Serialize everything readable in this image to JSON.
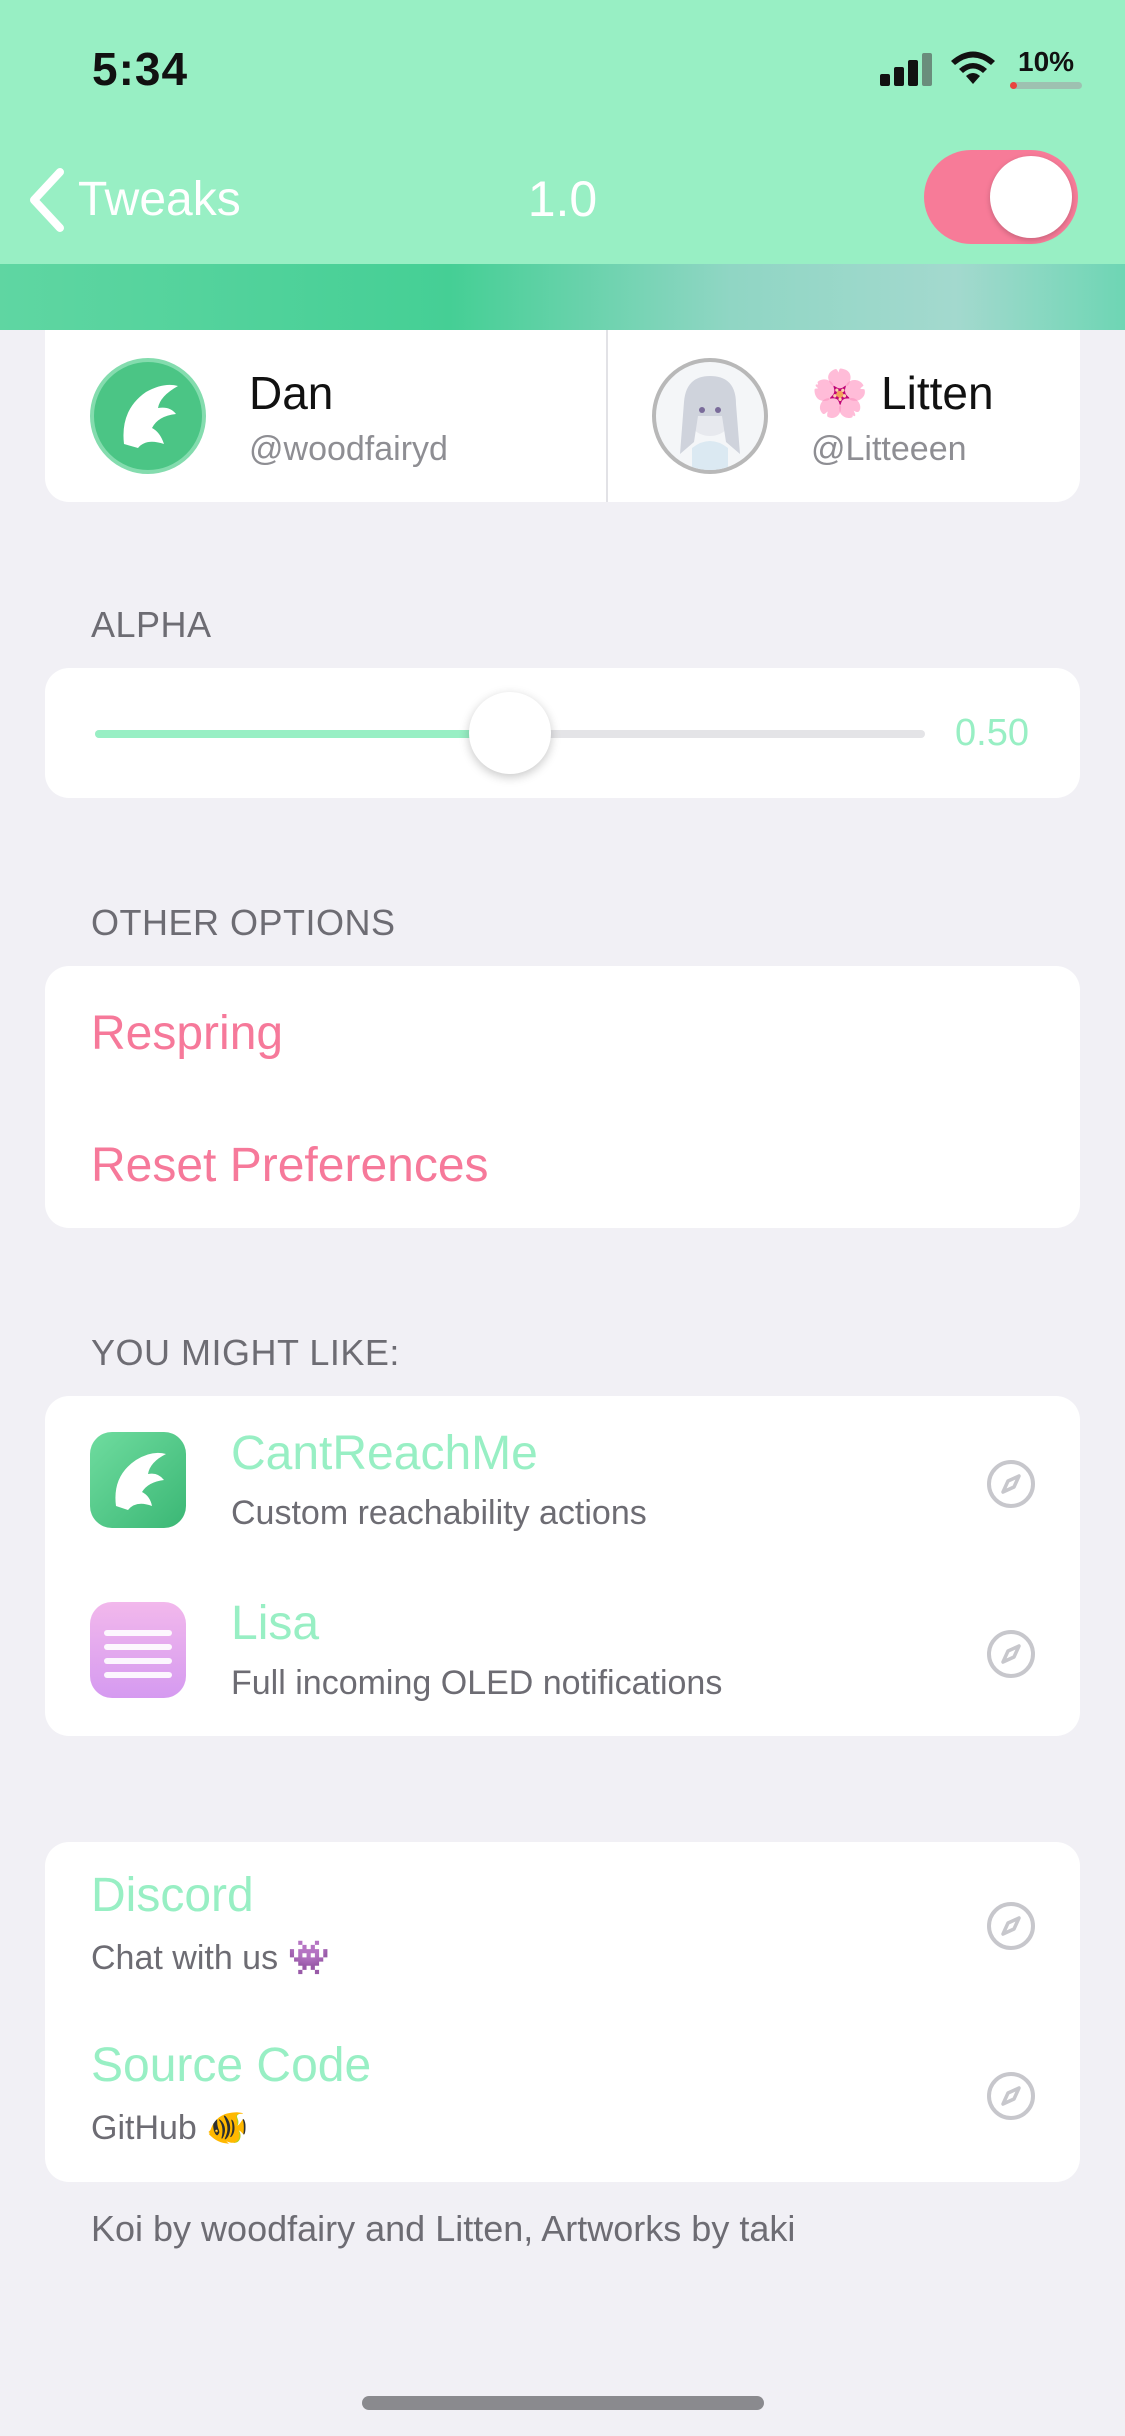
{
  "status_bar": {
    "time": "5:34",
    "battery": "10%",
    "battery_level": 0.1
  },
  "nav": {
    "back_label": "Tweaks",
    "title": "1.0",
    "toggle_on": true
  },
  "authors": [
    {
      "name": "Dan",
      "handle": "@woodfairyd"
    },
    {
      "name": "🌸 Litten",
      "handle": "@Litteeen"
    }
  ],
  "alpha": {
    "label": "ALPHA",
    "value": 0.5,
    "value_text": "0.50"
  },
  "other_options": {
    "label": "OTHER OPTIONS",
    "items": [
      "Respring",
      "Reset Preferences"
    ]
  },
  "you_might_like": {
    "label": "YOU MIGHT LIKE:",
    "items": [
      {
        "title": "CantReachMe",
        "subtitle": "Custom reachability actions",
        "icon": "cantreachme-icon"
      },
      {
        "title": "Lisa",
        "subtitle": "Full incoming OLED notifications",
        "icon": "lisa-icon"
      }
    ]
  },
  "links": [
    {
      "title": "Discord",
      "subtitle": "Chat with us 👾"
    },
    {
      "title": "Source Code",
      "subtitle": "GitHub 🐠"
    }
  ],
  "footer": "Koi by woodfairy and Litten, Artworks by taki",
  "colors": {
    "accent": "#98efc4",
    "pink": "#f6799a",
    "toggle": "#f77b98",
    "background": "#f1f0f5"
  }
}
